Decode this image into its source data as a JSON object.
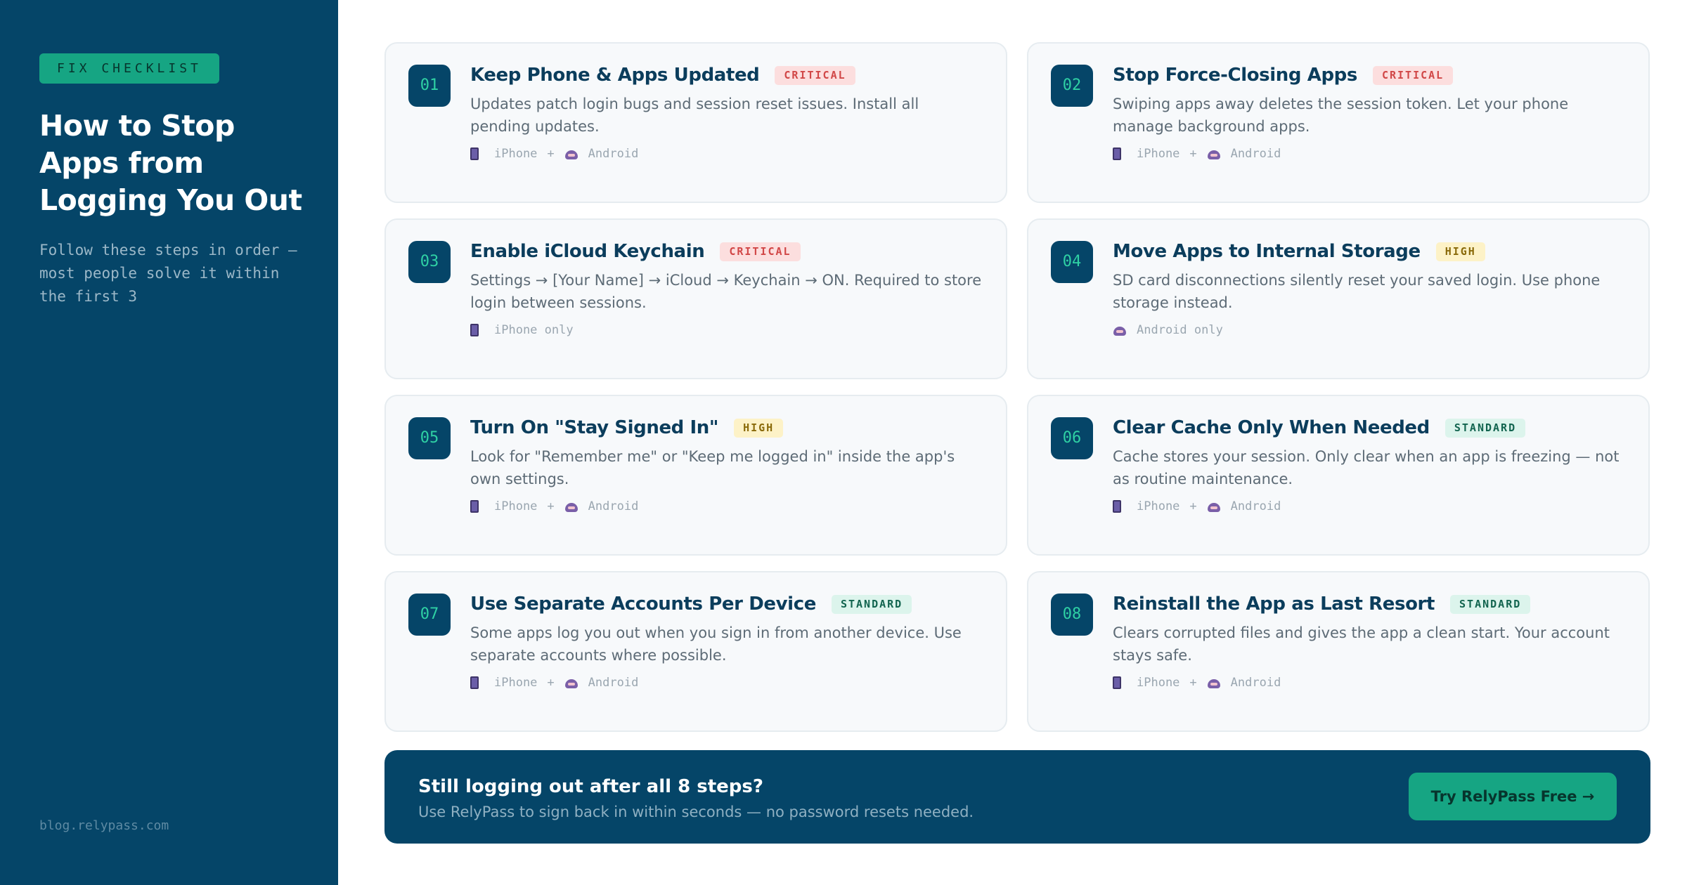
{
  "sidebar": {
    "eyebrow": "FIX CHECKLIST",
    "title": "How to Stop Apps from Logging You Out",
    "subtitle": "Follow these steps in order — most people solve it within the first 3",
    "footer": "blog.relypass.com"
  },
  "steps": [
    {
      "num": "01",
      "title": "Keep Phone & Apps Updated",
      "badge": "CRITICAL",
      "desc": "Updates patch login bugs and session reset issues. Install all pending updates.",
      "plat_a": "iPhone",
      "plat_sep": "+",
      "plat_b": "Android"
    },
    {
      "num": "02",
      "title": "Stop Force-Closing Apps",
      "badge": "CRITICAL",
      "desc": "Swiping apps away deletes the session token. Let your phone manage background apps.",
      "plat_a": "iPhone",
      "plat_sep": "+",
      "plat_b": "Android"
    },
    {
      "num": "03",
      "title": "Enable iCloud Keychain",
      "badge": "CRITICAL",
      "desc": "Settings → [Your Name] → iCloud → Keychain → ON. Required to store login between sessions.",
      "plat_a": "iPhone only"
    },
    {
      "num": "04",
      "title": "Move Apps to Internal Storage",
      "badge": "HIGH",
      "desc": "SD card disconnections silently reset your saved login. Use phone storage instead.",
      "plat_b": "Android only"
    },
    {
      "num": "05",
      "title": "Turn On \"Stay Signed In\"",
      "badge": "HIGH",
      "desc": "Look for \"Remember me\" or \"Keep me logged in\" inside the app's own settings.",
      "plat_a": "iPhone",
      "plat_sep": "+",
      "plat_b": "Android"
    },
    {
      "num": "06",
      "title": "Clear Cache Only When Needed",
      "badge": "STANDARD",
      "desc": "Cache stores your session. Only clear when an app is freezing — not as routine maintenance.",
      "plat_a": "iPhone",
      "plat_sep": "+",
      "plat_b": "Android"
    },
    {
      "num": "07",
      "title": "Use Separate Accounts Per Device",
      "badge": "STANDARD",
      "desc": "Some apps log you out when you sign in from another device. Use separate accounts where possible.",
      "plat_a": "iPhone",
      "plat_sep": "+",
      "plat_b": "Android"
    },
    {
      "num": "08",
      "title": "Reinstall the App as Last Resort",
      "badge": "STANDARD",
      "desc": "Clears corrupted files and gives the app a clean start. Your account stays safe.",
      "plat_a": "iPhone",
      "plat_sep": "+",
      "plat_b": "Android"
    }
  ],
  "icons": {
    "iphone": "phone-icon",
    "android": "android-icon"
  },
  "colors": {
    "navy": "#054568",
    "accent": "#16a583",
    "critical": "#d14747",
    "high": "#8a6a0a",
    "standard": "#12644f"
  },
  "cta": {
    "title": "Still logging out after all 8 steps?",
    "subtitle": "Use RelyPass to sign back in within seconds — no password resets needed.",
    "button": "Try RelyPass Free →"
  }
}
